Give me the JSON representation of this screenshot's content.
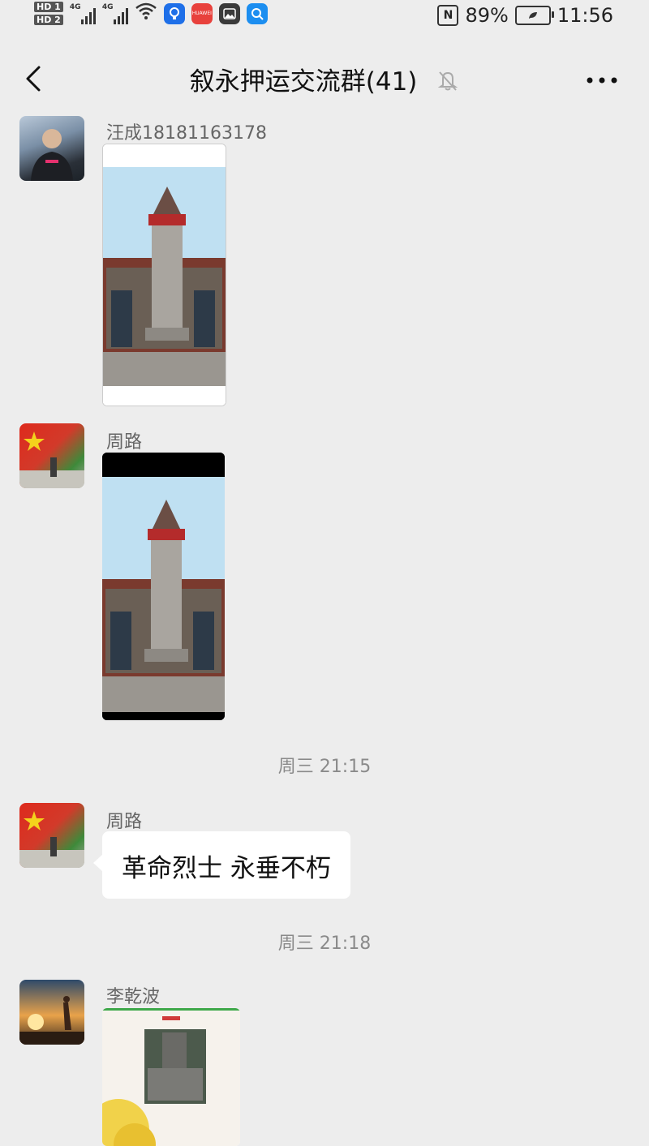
{
  "status_bar": {
    "sim1": "HD 1",
    "sim2": "HD 2",
    "net1": "4G",
    "net2": "4G",
    "huawei_label": "HUAWEI",
    "nfc": "N",
    "battery": "89%",
    "time": "11:56"
  },
  "header": {
    "title": "叙永押运交流群(41)"
  },
  "messages": [
    {
      "sender": "汪成18181163178",
      "type": "image"
    },
    {
      "sender": "周路",
      "type": "image"
    },
    {
      "timestamp": "周三 21:15"
    },
    {
      "sender": "周路",
      "type": "text",
      "text": "革命烈士 永垂不朽"
    },
    {
      "timestamp": "周三 21:18"
    },
    {
      "sender": "李乾波",
      "type": "image"
    }
  ],
  "colors": {
    "background": "#ededed",
    "bubble": "#ffffff",
    "sender_text": "#666666",
    "timestamp_text": "#8a8a8a"
  }
}
